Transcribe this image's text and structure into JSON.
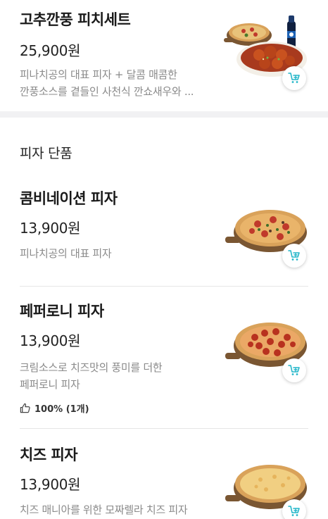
{
  "featured_set": {
    "name": "고추깐풍 피치세트",
    "price": "25,900원",
    "description_line1": "피나치공의 대표 피자 + 달콤 매콤한",
    "description_line2": "깐풍소스를 곁들인 사천식 깐쇼새우와 ..."
  },
  "section": {
    "title": "피자 단품"
  },
  "pizzas": [
    {
      "name": "콤비네이션 피자",
      "price": "13,900원",
      "description_line1": "피나치공의 대표 피자",
      "description_line2": ""
    },
    {
      "name": "페퍼로니 피자",
      "price": "13,900원",
      "description_line1": "크림소스로 치즈맛의 풍미를 더한",
      "description_line2": "페퍼로니 피자",
      "review": "100% (1개)"
    },
    {
      "name": "치즈 피자",
      "price": "13,900원",
      "description_line1": "치즈 매니아를 위한 모짜렐라 치즈 피자",
      "description_line2": ""
    }
  ],
  "icons": {
    "cart": "add-to-cart-icon",
    "thumbs_up": "thumbs-up-icon"
  },
  "colors": {
    "accent": "#22b6c9",
    "muted_text": "#8a8a8a",
    "section_gap": "#f1f1f3"
  }
}
